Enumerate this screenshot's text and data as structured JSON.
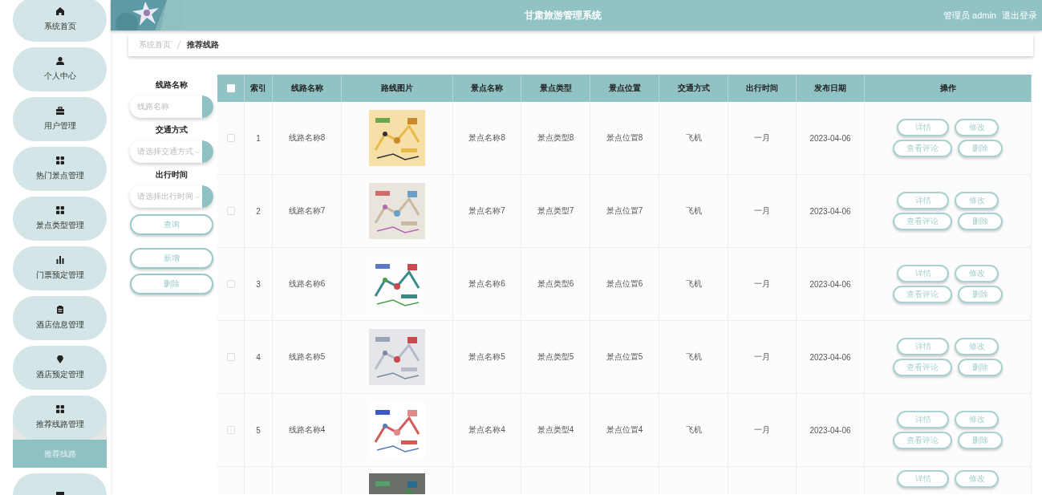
{
  "header": {
    "title": "甘肃旅游管理系统",
    "user": "管理员 admin",
    "logout": "退出登录"
  },
  "sidebar": {
    "items": [
      {
        "label": "系统首页",
        "expanded": false
      },
      {
        "label": "个人中心",
        "expanded": false
      },
      {
        "label": "用户管理",
        "expanded": false
      },
      {
        "label": "热门景点管理",
        "expanded": false
      },
      {
        "label": "景点类型管理",
        "expanded": false
      },
      {
        "label": "门票预定管理",
        "expanded": false
      },
      {
        "label": "酒店信息管理",
        "expanded": false
      },
      {
        "label": "酒店预定管理",
        "expanded": false
      },
      {
        "label": "推荐线路管理",
        "expanded": true,
        "children": [
          {
            "label": "推荐线路",
            "selected": true
          }
        ]
      },
      {
        "expanded": false
      }
    ]
  },
  "breadcrumb": [
    "系统首页",
    "推荐线路"
  ],
  "search": {
    "fields": [
      {
        "label": "线路名称",
        "kind": "text",
        "placeholder": "线路名称"
      },
      {
        "label": "交通方式",
        "kind": "select",
        "placeholder": "请选择交通方式"
      },
      {
        "label": "出行时间",
        "kind": "select",
        "placeholder": "请选择出行时间"
      }
    ],
    "buttons": [
      "查询",
      "新增",
      "删除"
    ]
  },
  "table": {
    "header_checked": false,
    "columns": [
      "索引",
      "线路名称",
      "路线图片",
      "景点名称",
      "景点类型",
      "景点位置",
      "交通方式",
      "出行时间",
      "发布日期",
      "操作"
    ],
    "rows": [
      {
        "checked": false,
        "cells": [
          "1",
          "线路名称8",
          null,
          "景点名称8",
          "景点类型8",
          "景点位置8",
          "飞机",
          "一月",
          "2023-04-06"
        ],
        "image": {
          "kind": "picture"
        },
        "actions": [
          "详情",
          "修改",
          "查看评论",
          "删除"
        ]
      },
      {
        "checked": false,
        "cells": [
          "2",
          "线路名称7",
          null,
          "景点名称7",
          "景点类型7",
          "景点位置7",
          "飞机",
          "一月",
          "2023-04-06"
        ],
        "image": {
          "kind": "picture"
        },
        "actions": [
          "详情",
          "修改",
          "查看评论",
          "删除"
        ]
      },
      {
        "checked": false,
        "cells": [
          "3",
          "线路名称6",
          null,
          "景点名称6",
          "景点类型6",
          "景点位置6",
          "飞机",
          "一月",
          "2023-04-06"
        ],
        "image": {
          "kind": "picture"
        },
        "actions": [
          "详情",
          "修改",
          "查看评论",
          "删除"
        ]
      },
      {
        "checked": false,
        "cells": [
          "4",
          "线路名称5",
          null,
          "景点名称5",
          "景点类型5",
          "景点位置5",
          "飞机",
          "一月",
          "2023-04-06"
        ],
        "image": {
          "kind": "picture"
        },
        "actions": [
          "详情",
          "修改",
          "查看评论",
          "删除"
        ]
      },
      {
        "checked": false,
        "cells": [
          "5",
          "线路名称4",
          null,
          "景点名称4",
          "景点类型4",
          "景点位置4",
          "飞机",
          "一月",
          "2023-04-06"
        ],
        "image": {
          "kind": "picture"
        },
        "actions": [
          "详情",
          "修改",
          "查看评论",
          "删除"
        ]
      },
      {
        "image": {
          "kind": "picture"
        },
        "actions": [
          "详情",
          "修改"
        ]
      }
    ]
  }
}
